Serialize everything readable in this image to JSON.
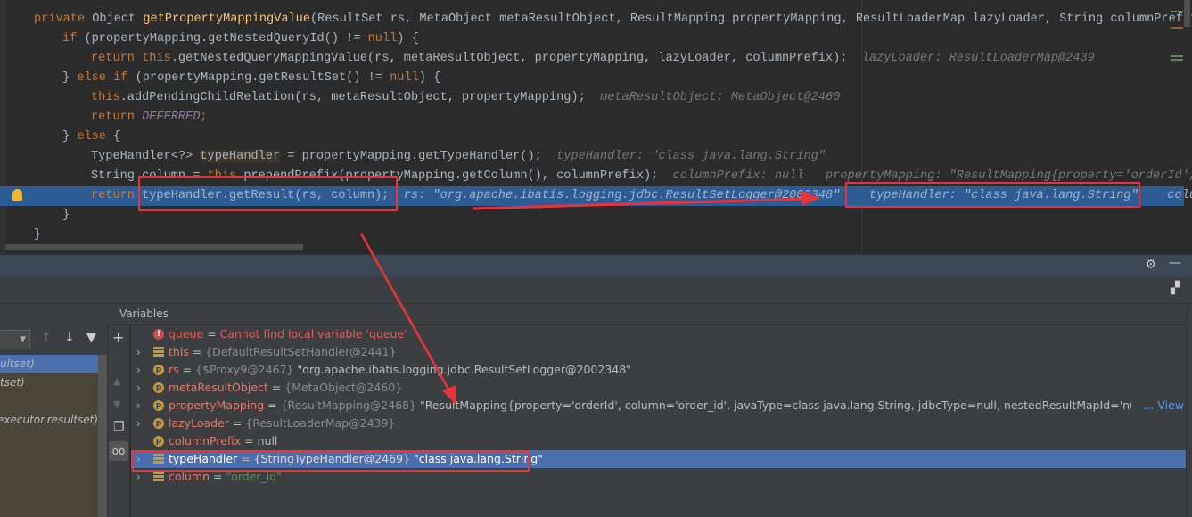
{
  "code": {
    "l1": {
      "kw": "private ",
      "type": "Object ",
      "fn": "getPropertyMappingValue",
      "rest": "(ResultSet rs, MetaObject metaResultObject, ResultMapping propertyMapping, ResultLoaderMap lazyLoader, String columnPrefix) {"
    },
    "l2": {
      "kw": "if ",
      "a": "(propertyMapping.getNestedQueryId() != ",
      "null": "null",
      "b": ") {"
    },
    "l3": {
      "kw": "return ",
      "this": "this",
      ".rest": ".getNestedQueryMappingValue(rs, metaResultObject, propertyMapping, lazyLoader, columnPrefix);",
      "hint": "lazyLoader: ResultLoaderMap@2439"
    },
    "l4": {
      "a": "} ",
      "kw": "else if ",
      "b": "(propertyMapping.getResultSet() != ",
      "null": "null",
      "c": ") {"
    },
    "l5": {
      "this": "this",
      "rest": ".addPendingChildRelation(rs, metaResultObject, propertyMapping);",
      "hint": "metaResultObject: MetaObject@2460"
    },
    "l6": {
      "kw": "return ",
      "const": "DEFERRED",
      "semi": ";"
    },
    "l7": {
      "a": "} ",
      "kw": "else ",
      "b": "{"
    },
    "l8": {
      "a": "TypeHandler<?> ",
      "var": "typeHandler",
      "b": " = propertyMapping.getTypeHandler();",
      "hint": "typeHandler: \"class java.lang.String\""
    },
    "l9": {
      "a": "String column = ",
      "this": "this",
      "b": ".prependPrefix(propertyMapping.getColumn(), columnPrefix);",
      "hint1": "columnPrefix: null",
      "hint2": "propertyMapping: \"ResultMapping{property='orderId', "
    },
    "l10": {
      "kw": "return ",
      "b": "typeHandler.getResult(rs, column);",
      "hint1": "rs: \"org.apache.ibatis.logging.jdbc.ResultSetLogger@2002348\"",
      "hint2": "typeHandler: \"class java.lang.String\"",
      "hint3": "colum"
    },
    "l11": "}",
    "l12": "}"
  },
  "debugger": {
    "variables_title": "Variables",
    "frames": [
      "ultset)",
      "tset)",
      "executor.resultset)"
    ],
    "variables": [
      {
        "name": "queue",
        "sep": " = ",
        "error": "Cannot find local variable 'queue'",
        "icon": "error-icon"
      },
      {
        "name": "this",
        "sep": " = ",
        "type": "{DefaultResultSetHandler@2441}",
        "icon": "field-icon"
      },
      {
        "name": "rs",
        "sep": " = ",
        "type": "{$Proxy9@2467}",
        "value": " \"org.apache.ibatis.logging.jdbc.ResultSetLogger@2002348\"",
        "icon": "parameter-icon"
      },
      {
        "name": "metaResultObject",
        "sep": " = ",
        "type": "{MetaObject@2460}",
        "icon": "parameter-icon"
      },
      {
        "name": "propertyMapping",
        "sep": " = ",
        "type": "{ResultMapping@2468}",
        "value": " \"ResultMapping{property='orderId', column='order_id', javaType=class java.lang.String, jdbcType=null, nestedResultMapId='null', nestedQuery",
        "link": "... View",
        "icon": "parameter-icon"
      },
      {
        "name": "lazyLoader",
        "sep": " = ",
        "type": "{ResultLoaderMap@2439}",
        "icon": "parameter-icon"
      },
      {
        "name": "columnPrefix",
        "sep": " = ",
        "value": "null",
        "icon": "parameter-icon"
      },
      {
        "name": "typeHandler",
        "sep": " = ",
        "type": "{StringTypeHandler@2469}",
        "value": " \"class java.lang.String\"",
        "icon": "field-icon",
        "selected": true
      },
      {
        "name": "column",
        "sep": " = ",
        "str": "\"order_id\"",
        "icon": "field-icon"
      }
    ]
  },
  "colors": {
    "annotation": "#e8333a",
    "execution_line": "#2d5c94",
    "selection": "#4b6eaf"
  }
}
